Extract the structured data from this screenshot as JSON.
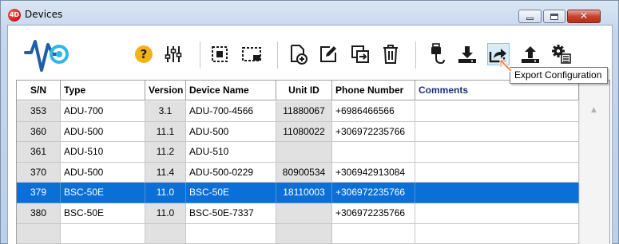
{
  "window": {
    "title": "Devices",
    "app_icon_text": "4D"
  },
  "toolbar": {
    "buttons": [
      {
        "name": "help-button",
        "icon": "question-icon"
      },
      {
        "name": "settings-button",
        "icon": "sliders-icon"
      },
      {
        "name": "select-all-button",
        "icon": "select-all-icon"
      },
      {
        "name": "deselect-button",
        "icon": "select-region-icon"
      },
      {
        "name": "new-device-button",
        "icon": "new-document-icon"
      },
      {
        "name": "edit-device-button",
        "icon": "edit-icon"
      },
      {
        "name": "duplicate-device-button",
        "icon": "duplicate-icon"
      },
      {
        "name": "delete-device-button",
        "icon": "trash-icon"
      },
      {
        "name": "connect-usb-button",
        "icon": "usb-cable-icon"
      },
      {
        "name": "import-configuration-button",
        "icon": "download-icon"
      },
      {
        "name": "export-configuration-button",
        "icon": "export-icon",
        "active": true
      },
      {
        "name": "upload-button",
        "icon": "upload-icon"
      },
      {
        "name": "configure-button",
        "icon": "gears-icon"
      }
    ],
    "tooltip": "Export Configuration"
  },
  "table": {
    "columns": [
      "S/N",
      "Type",
      "Version",
      "Device Name",
      "Unit ID",
      "Phone Number",
      "Comments"
    ],
    "rows": [
      {
        "sn": "353",
        "type": "ADU-700",
        "version": "3.1",
        "name": "ADU-700-4566",
        "unit_id": "11880067",
        "phone": "+6986466566",
        "comments": ""
      },
      {
        "sn": "360",
        "type": "ADU-500",
        "version": "11.1",
        "name": "ADU-500",
        "unit_id": "11080022",
        "phone": "+306972235766",
        "comments": ""
      },
      {
        "sn": "361",
        "type": "ADU-510",
        "version": "11.2",
        "name": "ADU-510",
        "unit_id": "",
        "phone": "",
        "comments": ""
      },
      {
        "sn": "370",
        "type": "ADU-500",
        "version": "11.4",
        "name": "ADU-500-0229",
        "unit_id": "80900534",
        "phone": "+306942913084",
        "comments": ""
      },
      {
        "sn": "379",
        "type": "BSC-50E",
        "version": "11.0",
        "name": "BSC-50E",
        "unit_id": "18110003",
        "phone": "+306972235766",
        "comments": "",
        "selected": true
      },
      {
        "sn": "380",
        "type": "BSC-50E",
        "version": "11.0",
        "name": "BSC-50E-7337",
        "unit_id": "",
        "phone": "+306972235766",
        "comments": ""
      },
      {
        "sn": "",
        "type": "",
        "version": "",
        "name": "",
        "unit_id": "",
        "phone": "",
        "comments": ""
      }
    ]
  },
  "colors": {
    "selection": "#0a6fd6",
    "comments_header": "#1f2f7a",
    "help_icon": "#f2b31a",
    "logo_blue": "#1f5fa8",
    "logo_cyan": "#2fb8e6"
  }
}
